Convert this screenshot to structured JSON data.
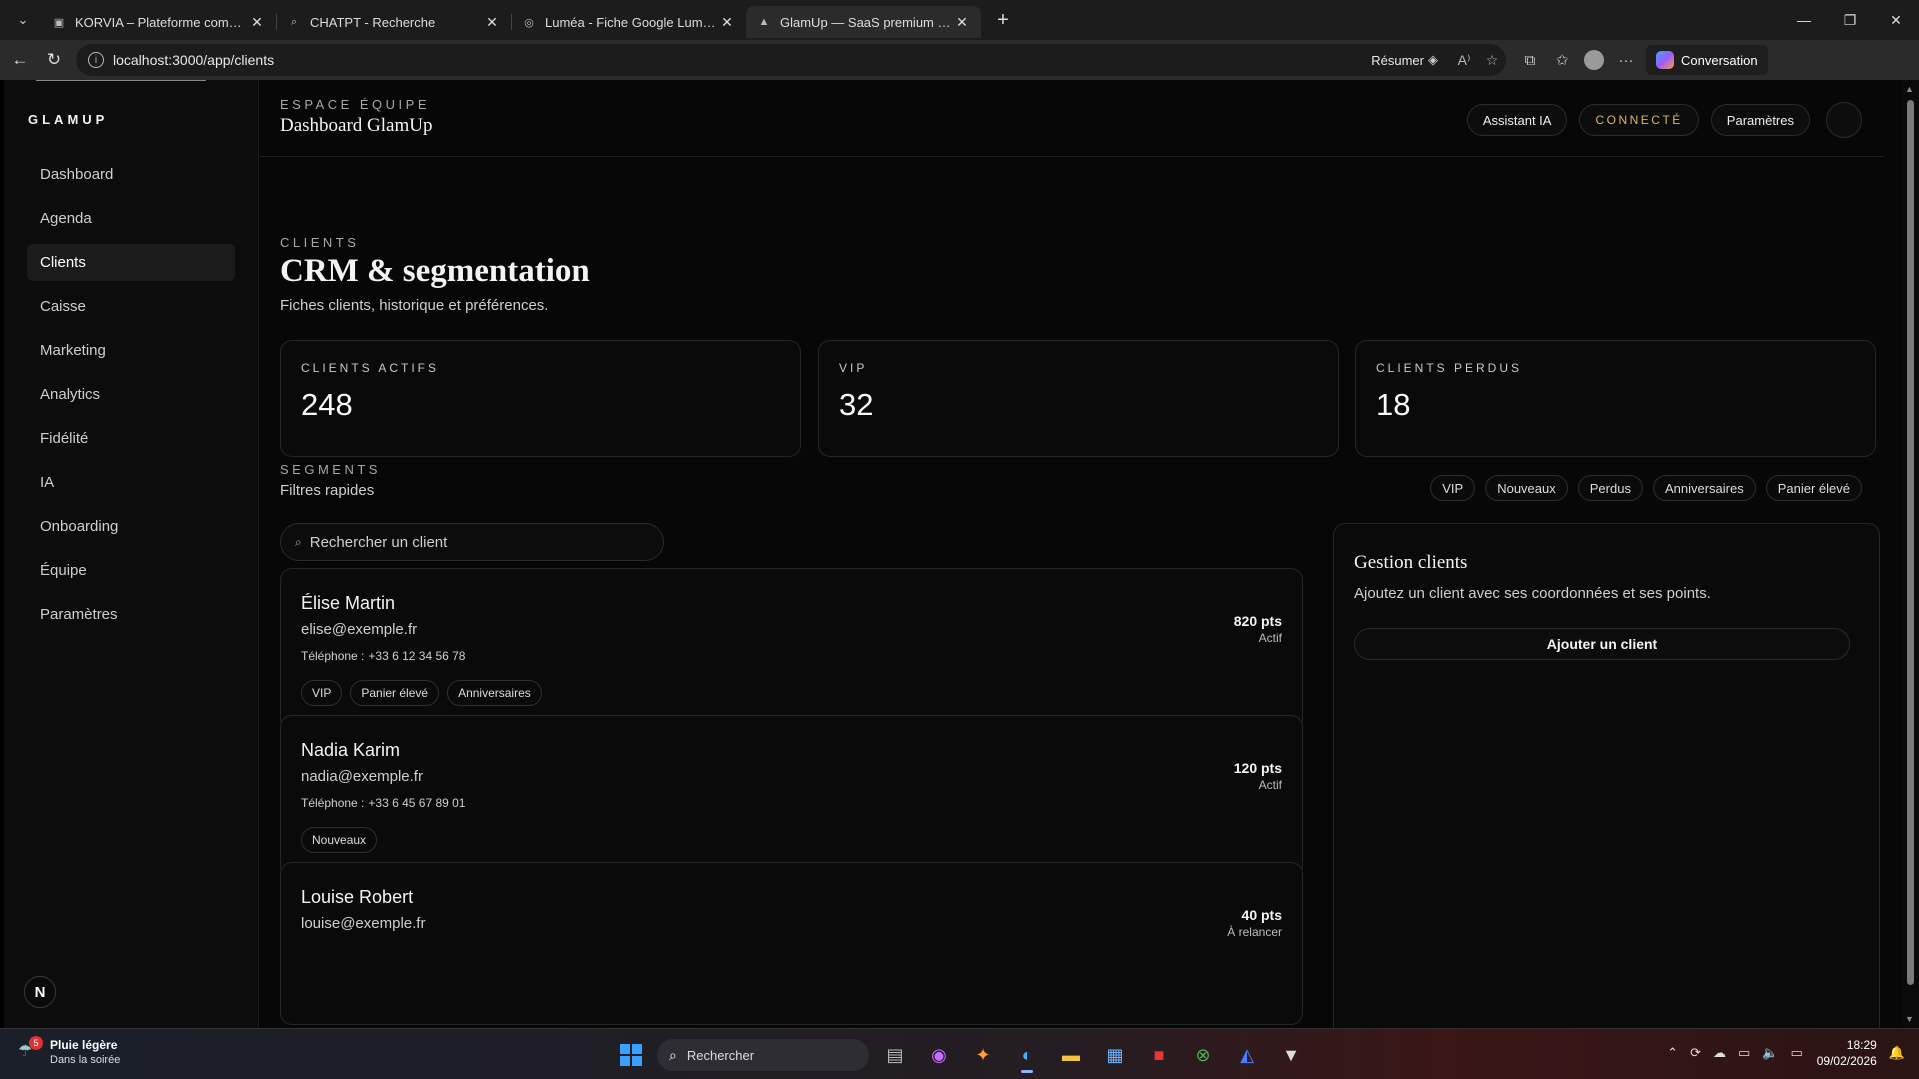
{
  "browser": {
    "tabs": [
      {
        "title": "KORVIA – Plateforme communaut",
        "favicon": "korvia-favicon-icon",
        "active": false
      },
      {
        "title": "CHATPT - Recherche",
        "favicon": "search-icon",
        "active": false
      },
      {
        "title": "Luméa - Fiche Google Luméa Solu",
        "favicon": "globe-icon",
        "active": false
      },
      {
        "title": "GlamUp — SaaS premium pour sa",
        "favicon": "triangle-icon",
        "active": true
      }
    ],
    "url": "localhost:3000/app/clients",
    "summarize_label": "Résumer",
    "conversation_label": "Conversation"
  },
  "sidebar": {
    "brand": "GLAMUP",
    "items": [
      {
        "label": "Dashboard",
        "active": false
      },
      {
        "label": "Agenda",
        "active": false
      },
      {
        "label": "Clients",
        "active": true
      },
      {
        "label": "Caisse",
        "active": false
      },
      {
        "label": "Marketing",
        "active": false
      },
      {
        "label": "Analytics",
        "active": false
      },
      {
        "label": "Fidélité",
        "active": false
      },
      {
        "label": "IA",
        "active": false
      },
      {
        "label": "Onboarding",
        "active": false
      },
      {
        "label": "Équipe",
        "active": false
      },
      {
        "label": "Paramètres",
        "active": false
      }
    ],
    "badge": "N"
  },
  "header": {
    "eyebrow": "ESPACE ÉQUIPE",
    "title": "Dashboard GlamUp",
    "assistant_label": "Assistant IA",
    "status_label": "CONNECTÉ",
    "settings_label": "Paramètres"
  },
  "main": {
    "eyebrow": "CLIENTS",
    "title": "CRM & segmentation",
    "subtitle": "Fiches clients, historique et préférences.",
    "stats": [
      {
        "label": "CLIENTS ACTIFS",
        "value": "248"
      },
      {
        "label": "VIP",
        "value": "32"
      },
      {
        "label": "CLIENTS PERDUS",
        "value": "18"
      }
    ],
    "segments": {
      "eyebrow": "SEGMENTS",
      "subtitle": "Filtres rapides",
      "chips": [
        "VIP",
        "Nouveaux",
        "Perdus",
        "Anniversaires",
        "Panier élevé"
      ]
    },
    "search": {
      "placeholder": "Rechercher un client"
    },
    "clients": [
      {
        "name": "Élise Martin",
        "email": "elise@exemple.fr",
        "phone_label": "Téléphone :",
        "phone": "+33 6 12 34 56 78",
        "points": "820 pts",
        "status": "Actif",
        "tags": [
          "VIP",
          "Panier élevé",
          "Anniversaires"
        ]
      },
      {
        "name": "Nadia Karim",
        "email": "nadia@exemple.fr",
        "phone_label": "Téléphone :",
        "phone": "+33 6 45 67 89 01",
        "points": "120 pts",
        "status": "Actif",
        "tags": [
          "Nouveaux"
        ]
      },
      {
        "name": "Louise Robert",
        "email": "louise@exemple.fr",
        "phone_label": "",
        "phone": "",
        "points": "40 pts",
        "status": "À relancer",
        "tags": []
      }
    ],
    "panel": {
      "title": "Gestion clients",
      "description": "Ajoutez un client avec ses coordonnées et ses points.",
      "add_label": "Ajouter un client"
    }
  },
  "taskbar": {
    "weather_badge": "5",
    "weather_title": "Pluie légère",
    "weather_sub": "Dans la soirée",
    "search_label": "Rechercher",
    "time": "18:29",
    "date": "09/02/2026"
  }
}
